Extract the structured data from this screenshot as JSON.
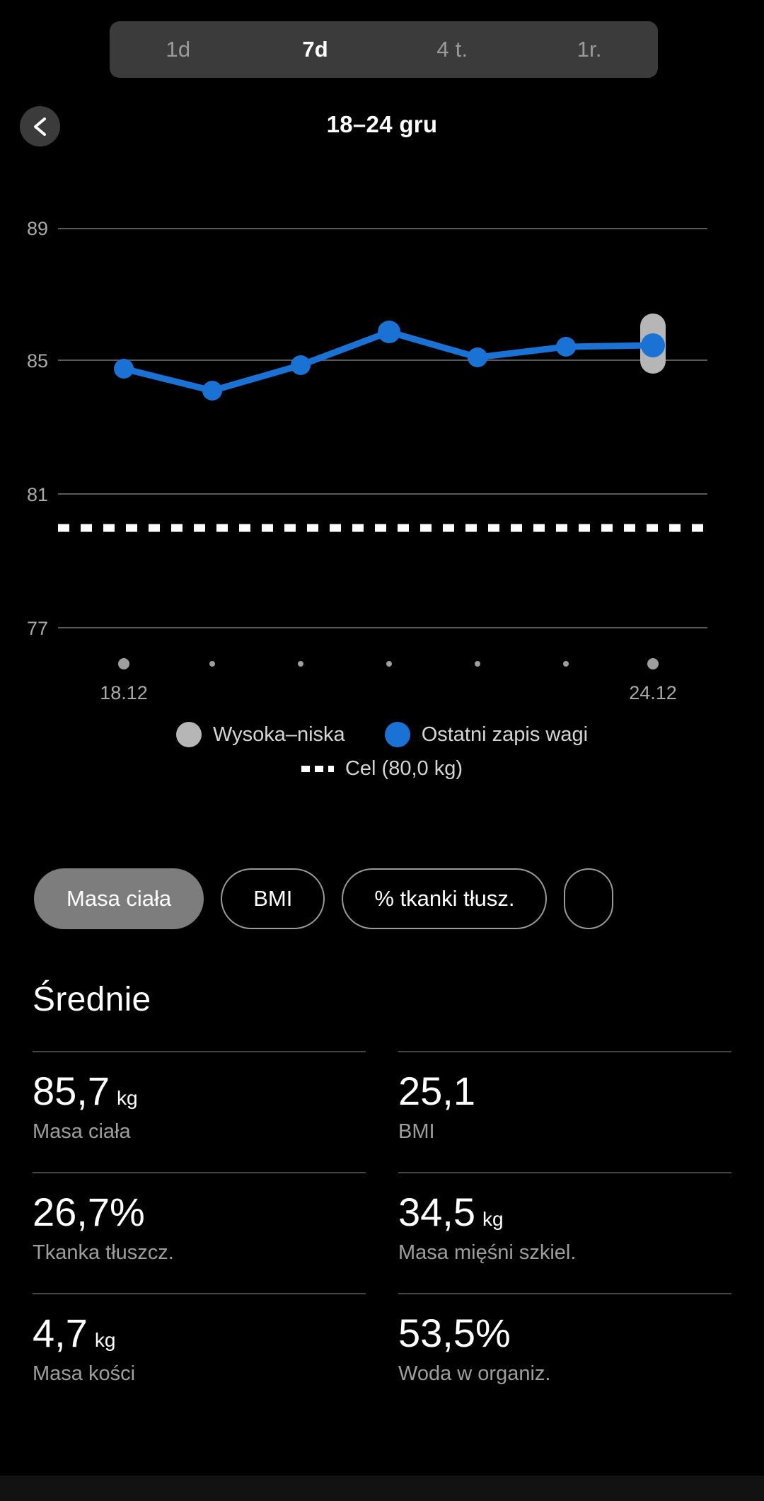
{
  "colors": {
    "background": "#000000",
    "accent_blue": "#1a73d4",
    "high_low_grey": "#b6b6b6",
    "tab_bar": "#3b3b3b",
    "chip_selected": "#7d7d7d",
    "gridline": "#5a5a5a",
    "goal_line": "#ffffff"
  },
  "period_tabs": [
    {
      "label": "1d",
      "selected": false
    },
    {
      "label": "7d",
      "selected": true
    },
    {
      "label": "4 t.",
      "selected": false
    },
    {
      "label": "1r.",
      "selected": false
    }
  ],
  "header": {
    "back_icon": "chevron-left-icon",
    "range_title": "18–24 gru"
  },
  "chart_data": {
    "type": "line",
    "title": "18–24 gru",
    "xlabel": "",
    "ylabel": "",
    "unit": "kg",
    "grid": true,
    "ylim": [
      77,
      89
    ],
    "yticks": [
      89,
      85,
      81,
      77
    ],
    "ytick_labels": [
      "89",
      "85",
      "81",
      "77"
    ],
    "x": [
      "18.12",
      "19.12",
      "20.12",
      "21.12",
      "22.12",
      "23.12",
      "24.12"
    ],
    "xtick_labels_shown": [
      "18.12",
      "24.12"
    ],
    "series": [
      {
        "name": "Ostatni zapis wagi",
        "color": "#1a73d4",
        "values": [
          85.4,
          85.1,
          85.45,
          86.1,
          85.6,
          85.75,
          85.75
        ]
      },
      {
        "name": "Wysoka–niska",
        "color": "#b6b6b6",
        "type": "range_marker",
        "at_x": "24.12",
        "high": 86.4,
        "low": 84.9
      }
    ],
    "goal_line": {
      "label": "Cel (80,0 kg)",
      "value": 80.0,
      "style": "dashed",
      "color": "#ffffff"
    },
    "legend": [
      {
        "marker": "circle",
        "color": "#b6b6b6",
        "label": "Wysoka–niska"
      },
      {
        "marker": "circle",
        "color": "#1a73d4",
        "label": "Ostatni zapis wagi"
      },
      {
        "marker": "dashed",
        "color": "#ffffff",
        "label": "Cel (80,0 kg)"
      }
    ],
    "legend_position": "bottom"
  },
  "metric_chips": [
    {
      "label": "Masa ciała",
      "selected": true
    },
    {
      "label": "BMI",
      "selected": false
    },
    {
      "label": "% tkanki tłusz.",
      "selected": false
    },
    {
      "label": "",
      "selected": false
    }
  ],
  "averages": {
    "title": "Średnie",
    "items": [
      {
        "value": "85,7",
        "unit": "kg",
        "label": "Masa ciała"
      },
      {
        "value": "25,1",
        "unit": "",
        "label": "BMI"
      },
      {
        "value": "26,7%",
        "unit": "",
        "label": "Tkanka tłuszcz."
      },
      {
        "value": "34,5",
        "unit": "kg",
        "label": "Masa mięśni szkiel."
      },
      {
        "value": "4,7",
        "unit": "kg",
        "label": "Masa kości"
      },
      {
        "value": "53,5%",
        "unit": "",
        "label": "Woda w organiz."
      }
    ]
  }
}
